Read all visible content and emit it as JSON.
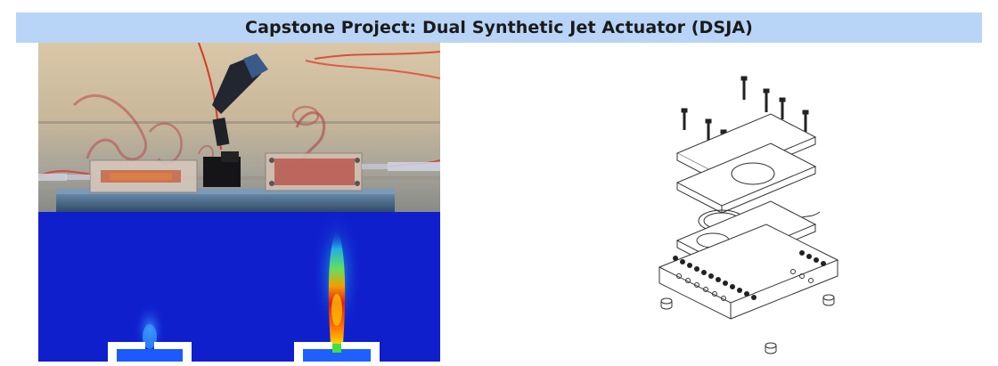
{
  "header": {
    "title": "Capstone Project: Dual Synthetic Jet Actuator (DSJA)",
    "background_color": "#b8d4f6"
  },
  "images": {
    "photo": "photograph of actuator prototype with red dye flow visualization in water tank",
    "simulation": "CFD velocity contour of dual synthetic jets",
    "drawing": "exploded assembly line drawing of actuator with screws and plates"
  }
}
